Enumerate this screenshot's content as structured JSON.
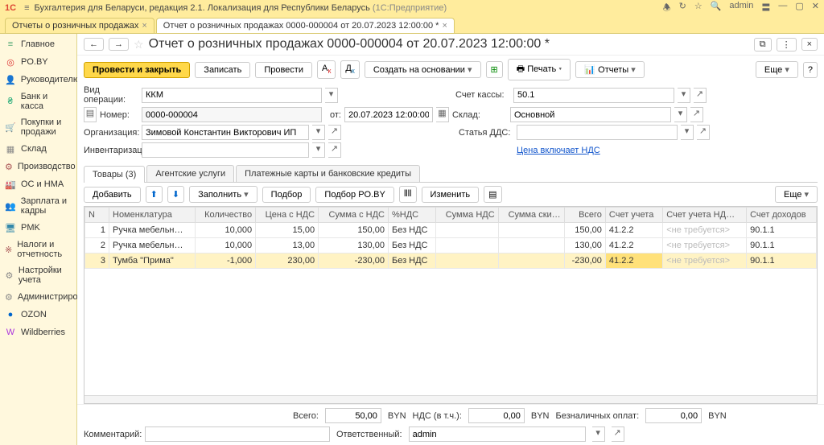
{
  "app": {
    "title": "Бухгалтерия для Беларуси, редакция 2.1. Локализация для Республики Беларусь",
    "subTitle": "(1С:Предприятие)",
    "user": "admin"
  },
  "tabs": [
    {
      "label": "Отчеты о розничных продажах"
    },
    {
      "label": "Отчет о розничных продажах 0000-000004 от 20.07.2023 12:00:00 *"
    }
  ],
  "sidebar": {
    "items": [
      {
        "label": "Главное",
        "icon": "≡",
        "color": "#5a7"
      },
      {
        "label": "PO.BY",
        "icon": "◎",
        "color": "#d33"
      },
      {
        "label": "Руководителю",
        "icon": "👤",
        "color": "#888"
      },
      {
        "label": "Банк и касса",
        "icon": "₴",
        "color": "#2a7"
      },
      {
        "label": "Покупки и продажи",
        "icon": "🛒",
        "color": "#a55"
      },
      {
        "label": "Склад",
        "icon": "▦",
        "color": "#888"
      },
      {
        "label": "Производство",
        "icon": "⚙",
        "color": "#a55"
      },
      {
        "label": "ОС и НМА",
        "icon": "🏭",
        "color": "#a55"
      },
      {
        "label": "Зарплата и кадры",
        "icon": "👥",
        "color": "#888"
      },
      {
        "label": "PMK",
        "icon": "🖥",
        "color": "#38a"
      },
      {
        "label": "Налоги и отчетность",
        "icon": "※",
        "color": "#a55"
      },
      {
        "label": "Настройки учета",
        "icon": "⚙",
        "color": "#888"
      },
      {
        "label": "Администрирование",
        "icon": "⚙",
        "color": "#888"
      },
      {
        "label": "OZON",
        "icon": "●",
        "color": "#06c"
      },
      {
        "label": "Wildberries",
        "icon": "W",
        "color": "#a3d"
      }
    ]
  },
  "doc": {
    "title": "Отчет о розничных продажах 0000-000004 от 20.07.2023 12:00:00 *"
  },
  "toolbar": {
    "post_close": "Провести и закрыть",
    "save": "Записать",
    "post": "Провести",
    "createby": "Создать на основании",
    "print": "Печать",
    "reports": "Отчеты",
    "more": "Еще"
  },
  "form": {
    "lbl_op": "Вид операции:",
    "op": "ККМ",
    "lbl_cash": "Счет кассы:",
    "cash": "50.1",
    "lbl_num": "Номер:",
    "num": "0000-000004",
    "lbl_from": "от:",
    "date": "20.07.2023 12:00:00",
    "lbl_wh": "Склад:",
    "wh": "Основной",
    "lbl_org": "Организация:",
    "org": "Зимовой Константин Викторович ИП",
    "lbl_dds": "Статья ДДС:",
    "dds": "",
    "lbl_inv": "Инвентаризация:",
    "inv": "",
    "vat_link": "Цена включает НДС"
  },
  "tabs2": {
    "goods": "Товары (3)",
    "agent": "Агентские услуги",
    "cards": "Платежные карты и банковские кредиты"
  },
  "tbltoolbar": {
    "add": "Добавить",
    "fill": "Заполнить",
    "pick": "Подбор",
    "pickby": "Подбор PO.BY",
    "edit": "Изменить",
    "more": "Еще"
  },
  "columns": {
    "n": "N",
    "nom": "Номенклатура",
    "qty": "Количество",
    "price": "Цена с НДС",
    "sum": "Сумма с НДС",
    "vatp": "%НДС",
    "vatsum": "Сумма НДС",
    "disc": "Сумма ски…",
    "total": "Всего",
    "acc": "Счет учета",
    "accvat": "Счет учета НД…",
    "accinc": "Счет доходов"
  },
  "rows": [
    {
      "n": "1",
      "nom": "Ручка мебельн…",
      "qty": "10,000",
      "price": "15,00",
      "sum": "150,00",
      "vatp": "Без НДС",
      "vatsum": "",
      "disc": "",
      "total": "150,00",
      "acc": "41.2.2",
      "accvat": "<не требуется>",
      "accinc": "90.1.1"
    },
    {
      "n": "2",
      "nom": "Ручка мебельн…",
      "qty": "10,000",
      "price": "13,00",
      "sum": "130,00",
      "vatp": "Без НДС",
      "vatsum": "",
      "disc": "",
      "total": "130,00",
      "acc": "41.2.2",
      "accvat": "<не требуется>",
      "accinc": "90.1.1"
    },
    {
      "n": "3",
      "nom": "Тумба \"Прима\"",
      "qty": "-1,000",
      "price": "230,00",
      "sum": "-230,00",
      "vatp": "Без НДС",
      "vatsum": "",
      "disc": "",
      "total": "-230,00",
      "acc": "41.2.2",
      "accvat": "<не требуется>",
      "accinc": "90.1.1"
    }
  ],
  "footer": {
    "lbl_total": "Всего:",
    "total": "50,00",
    "cur": "BYN",
    "lbl_vat": "НДС (в т.ч.):",
    "vat": "0,00",
    "lbl_nc": "Безналичных оплат:",
    "nc": "0,00",
    "lbl_comm": "Комментарий:",
    "comm": "",
    "lbl_resp": "Ответственный:",
    "resp": "admin"
  }
}
